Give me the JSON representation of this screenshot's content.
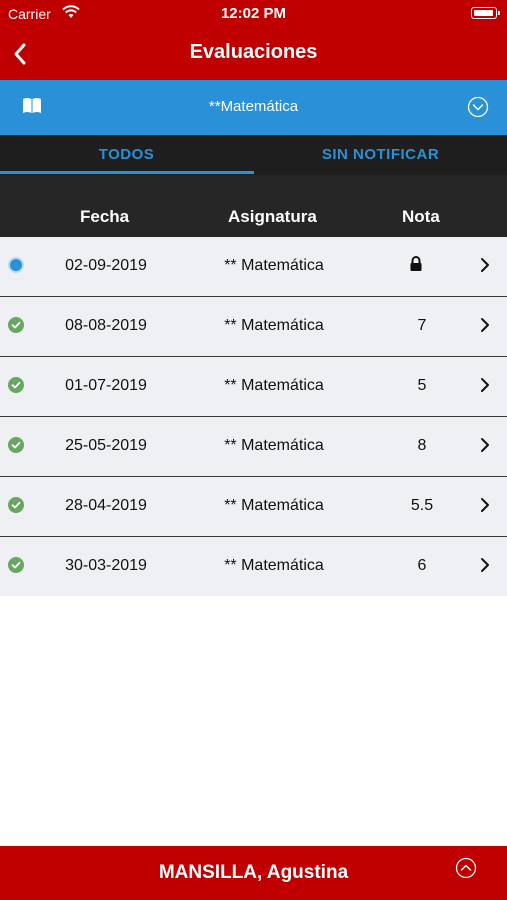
{
  "status_bar": {
    "carrier": "Carrier",
    "time": "12:02 PM"
  },
  "nav": {
    "title": "Evaluaciones",
    "back_icon": "chevron-left-icon"
  },
  "subject_bar": {
    "subject": "**Matemática",
    "icon": "book-icon",
    "toggle_icon": "chevron-down-circle-icon"
  },
  "tabs": [
    {
      "label": "TODOS",
      "active": true
    },
    {
      "label": "SIN NOTIFICAR",
      "active": false
    }
  ],
  "table": {
    "headers": {
      "date": "Fecha",
      "subject": "Asignatura",
      "grade": "Nota"
    },
    "rows": [
      {
        "status": "pending",
        "date": "02-09-2019",
        "subject": "** Matemática",
        "grade": "",
        "locked": true
      },
      {
        "status": "done",
        "date": "08-08-2019",
        "subject": "** Matemática",
        "grade": "7",
        "locked": false
      },
      {
        "status": "done",
        "date": "01-07-2019",
        "subject": "** Matemática",
        "grade": "5",
        "locked": false
      },
      {
        "status": "done",
        "date": "25-05-2019",
        "subject": "** Matemática",
        "grade": "8",
        "locked": false
      },
      {
        "status": "done",
        "date": "28-04-2019",
        "subject": "** Matemática",
        "grade": "5.5",
        "locked": false
      },
      {
        "status": "done",
        "date": "30-03-2019",
        "subject": "** Matemática",
        "grade": "6",
        "locked": false
      }
    ]
  },
  "footer": {
    "student_name": "MANSILLA, Agustina",
    "toggle_icon": "chevron-up-circle-icon"
  },
  "colors": {
    "primary_red": "#c00000",
    "accent_blue": "#2a90d8",
    "status_green": "#6aa663",
    "dark_header": "#262626"
  }
}
